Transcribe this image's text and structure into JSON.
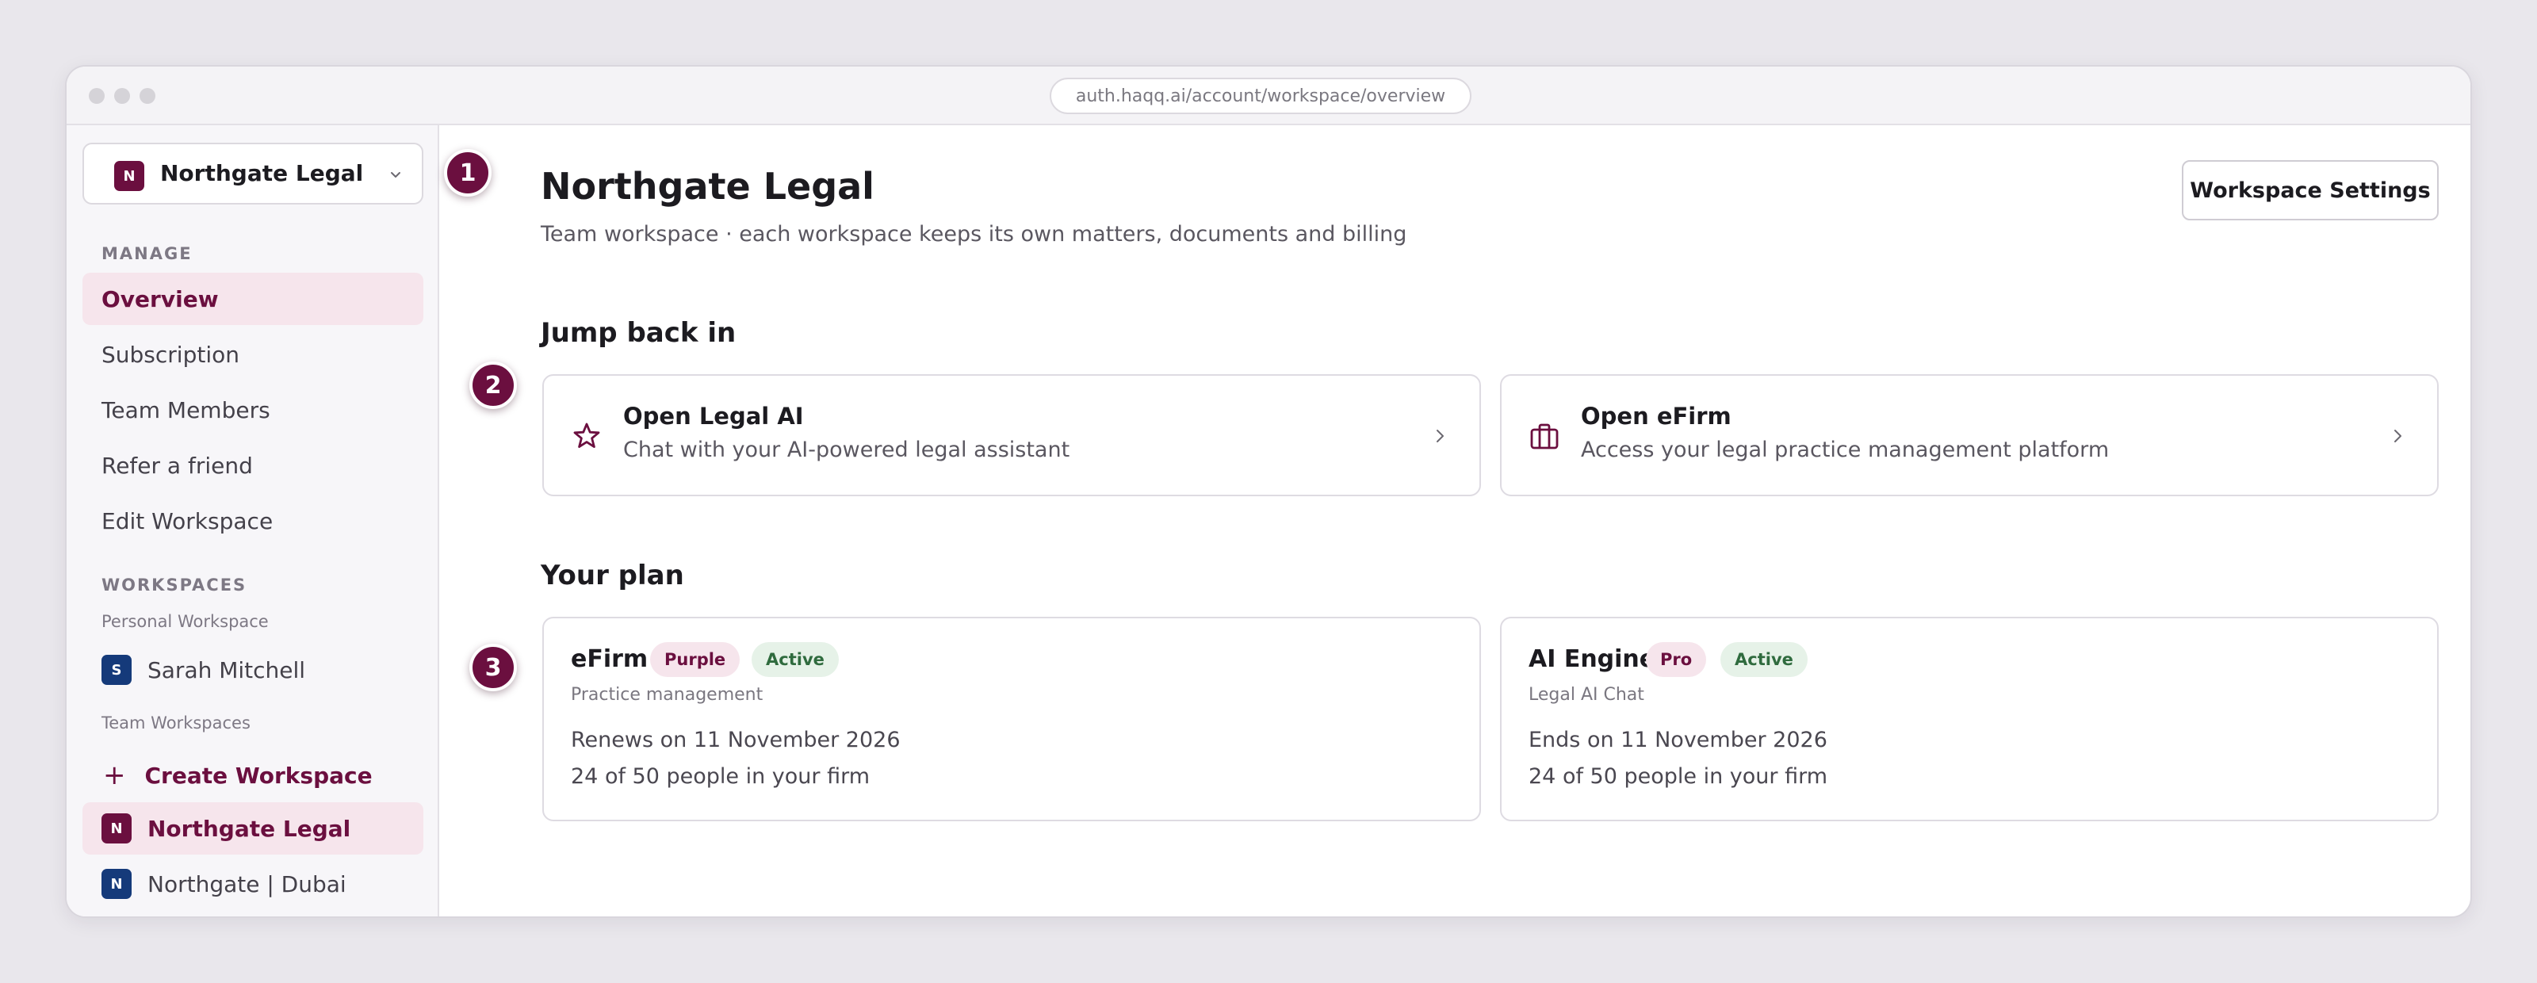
{
  "browser": {
    "url": "auth.haqq.ai/account/workspace/overview"
  },
  "sidebar": {
    "workspace_switcher": {
      "initial": "N",
      "name": "Northgate Legal"
    },
    "manage_heading": "MANAGE",
    "nav": [
      {
        "label": "Overview",
        "active": true
      },
      {
        "label": "Subscription"
      },
      {
        "label": "Team Members"
      },
      {
        "label": "Refer a friend"
      },
      {
        "label": "Edit Workspace"
      }
    ],
    "workspaces_heading": "WORKSPACES",
    "personal_heading": "Personal Workspace",
    "personal": {
      "initial": "S",
      "name": "Sarah Mitchell"
    },
    "team_heading": "Team Workspaces",
    "create_label": "Create Workspace",
    "team": [
      {
        "initial": "N",
        "name": "Northgate Legal",
        "active": true
      },
      {
        "initial": "N",
        "name": "Northgate | Dubai"
      }
    ]
  },
  "steps": [
    "1",
    "2",
    "3"
  ],
  "main": {
    "title": "Northgate Legal",
    "subtitle": "Team workspace · each workspace keeps its own matters, documents and billing",
    "settings_button": "Workspace Settings",
    "jump_heading": "Jump back in",
    "jump_cards": [
      {
        "title": "Open Legal AI",
        "desc": "Chat with your AI-powered legal assistant",
        "icon": "star-icon"
      },
      {
        "title": "Open eFirm",
        "desc": "Access your legal practice management platform",
        "icon": "briefcase-icon"
      }
    ],
    "plan_heading": "Your plan",
    "plans": [
      {
        "name": "eFirm",
        "tier": "Purple",
        "status": "Active",
        "category": "Practice management",
        "line1": "Renews on 11 November 2026",
        "line2": "24 of 50 people in your firm"
      },
      {
        "name": "AI Engine",
        "tier": "Pro",
        "status": "Active",
        "category": "Legal AI Chat",
        "line1": "Ends on 11 November 2026",
        "line2": "24 of 50 people in your firm"
      }
    ]
  },
  "colors": {
    "brand": "#6b0f3f",
    "brand_tint": "#f6e5ec",
    "navy": "#153a7a",
    "success_text": "#2f6b3e",
    "success_bg": "#e6f2e8"
  }
}
